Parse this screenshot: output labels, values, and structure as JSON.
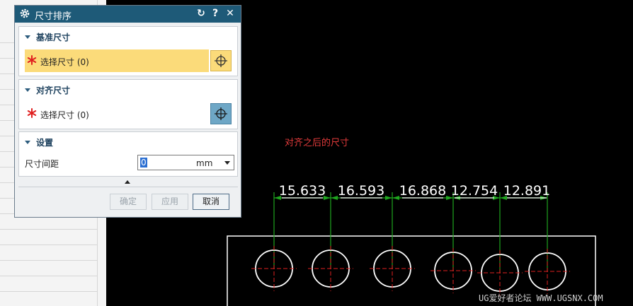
{
  "dialog": {
    "title": "尺寸排序",
    "reset_symbol": "↻",
    "help_symbol": "?",
    "close_symbol": "✕"
  },
  "groups": {
    "baseline": {
      "title": "基准尺寸",
      "select_label": "选择尺寸 (0)"
    },
    "align": {
      "title": "对齐尺寸",
      "select_label": "选择尺寸 (0)"
    },
    "settings": {
      "title": "设置",
      "spacing_label": "尺寸间距",
      "spacing_value": "0",
      "unit": "mm"
    }
  },
  "buttons": {
    "ok": "确定",
    "apply": "应用",
    "cancel": "取消"
  },
  "canvas": {
    "annotation": "对齐之后的尺寸",
    "dimensions": [
      "15.633",
      "16.593",
      "16.868",
      "12.754",
      "12.891"
    ],
    "watermark": "UG爱好者论坛 WWW.UGSNX.COM"
  },
  "colors": {
    "titlebar": "#1e5a78",
    "highlight": "#fbdb7a",
    "dimension_line": "#1fa51f",
    "annotation": "#e03a3a",
    "centerline": "#e02020"
  }
}
